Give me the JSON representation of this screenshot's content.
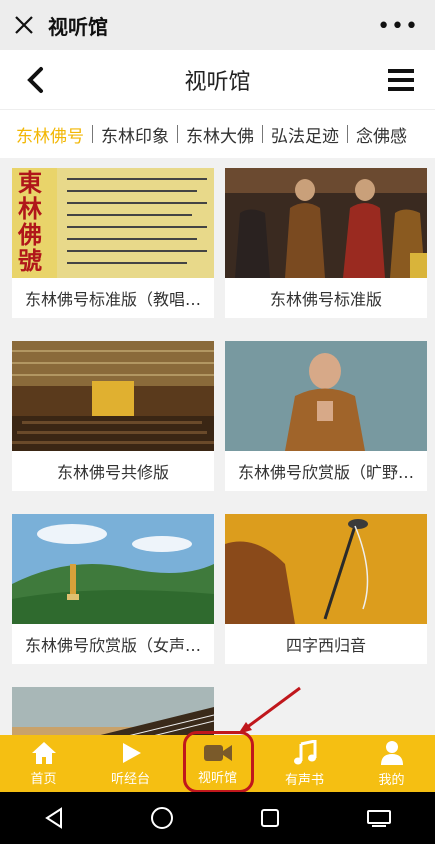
{
  "wechat": {
    "title": "视听馆",
    "more": "•••"
  },
  "header": {
    "title": "视听馆"
  },
  "tabs": [
    {
      "label": "东林佛号"
    },
    {
      "label": "东林印象"
    },
    {
      "label": "东林大佛"
    },
    {
      "label": "弘法足迹"
    },
    {
      "label": "念佛感"
    }
  ],
  "cards": [
    {
      "label": "东林佛号标准版（教唱…"
    },
    {
      "label": "东林佛号标准版"
    },
    {
      "label": "东林佛号共修版"
    },
    {
      "label": "东林佛号欣赏版（旷野…"
    },
    {
      "label": "东林佛号欣赏版（女声…"
    },
    {
      "label": "四字西归音"
    }
  ],
  "thumb_text": {
    "card1_calligraphy": "東林佛號"
  },
  "bottom_nav": [
    {
      "label": "首页",
      "icon": "home-icon"
    },
    {
      "label": "听经台",
      "icon": "play-icon"
    },
    {
      "label": "视听馆",
      "icon": "video-camera-icon"
    },
    {
      "label": "有声书",
      "icon": "music-note-icon"
    },
    {
      "label": "我的",
      "icon": "user-icon"
    }
  ],
  "colors": {
    "accent": "#f5bf12",
    "active_tab": "#f2b705",
    "highlight": "#c0171c"
  }
}
